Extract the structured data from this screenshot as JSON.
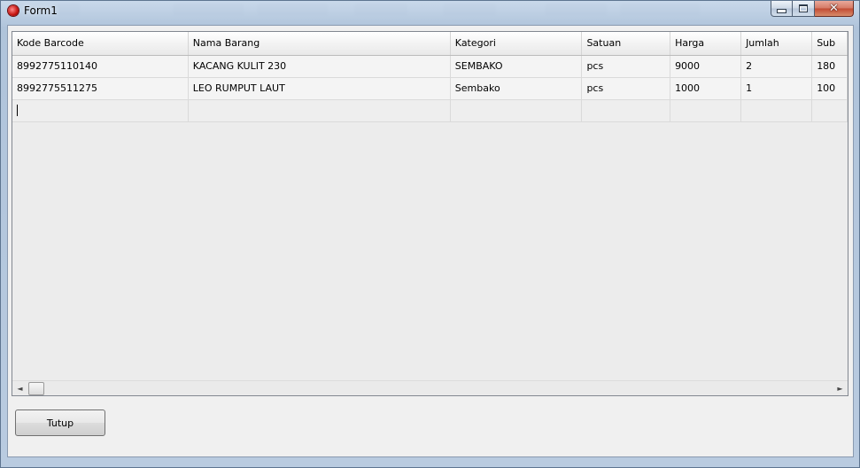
{
  "window": {
    "title": "Form1"
  },
  "caption": {
    "close_glyph": "✕"
  },
  "grid": {
    "columns": [
      "Kode Barcode",
      "Nama Barang",
      "Kategori",
      "Satuan",
      "Harga",
      "Jumlah",
      "Sub"
    ],
    "rows": [
      [
        "8992775110140",
        "KACANG KULIT 230",
        "SEMBAKO",
        "pcs",
        "9000",
        "2",
        "180"
      ],
      [
        "8992775511275",
        "LEO RUMPUT LAUT",
        "Sembako",
        "pcs",
        "1000",
        "1",
        "100"
      ]
    ]
  },
  "scrollbar": {
    "left_arrow": "◄",
    "right_arrow": "►"
  },
  "buttons": {
    "close_label": "Tutup"
  }
}
